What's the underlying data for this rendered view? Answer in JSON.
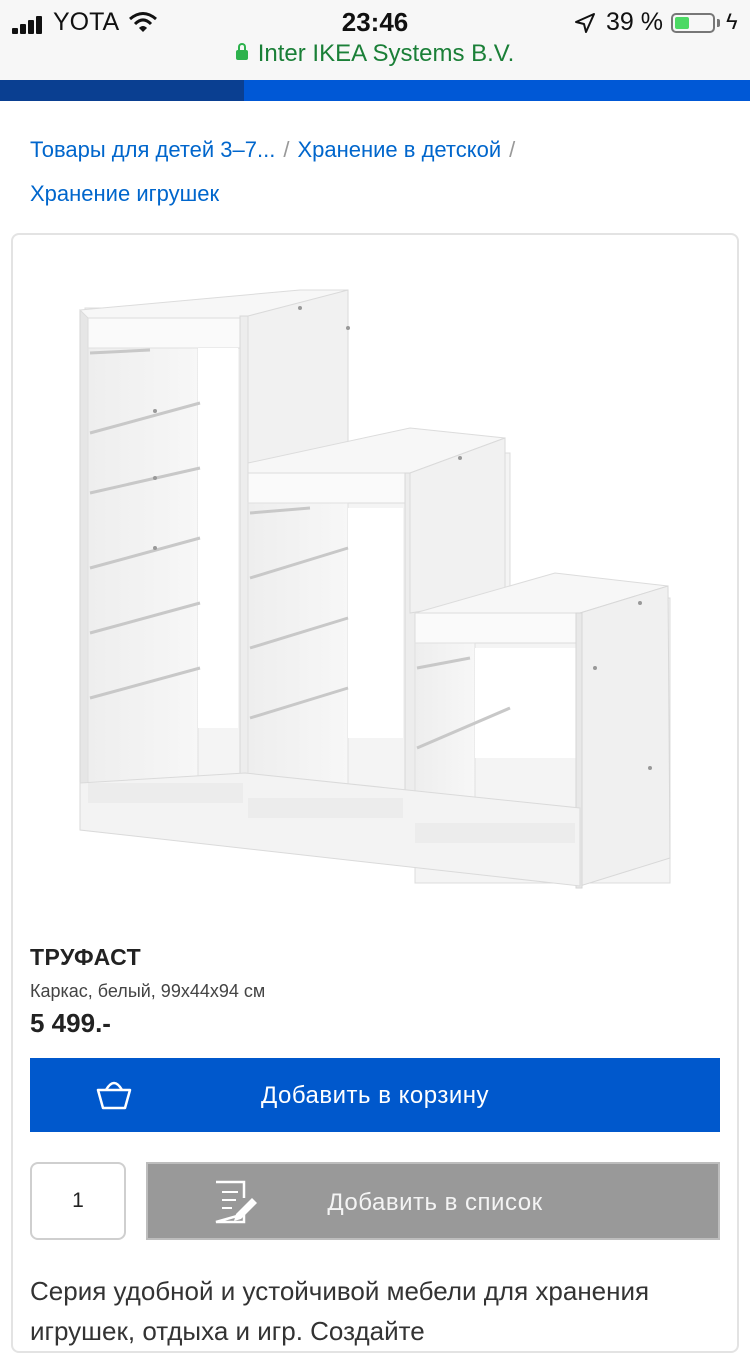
{
  "status_bar": {
    "carrier": "YOTA",
    "time": "23:46",
    "battery_percent": "39 %",
    "battery_level": 0.39
  },
  "browser": {
    "site_owner": "Inter IKEA Systems B.V.",
    "page_load_progress": 0.325
  },
  "breadcrumb": {
    "items": [
      "Товары для детей 3–7...",
      "Хранение в детской",
      "Хранение игрушек"
    ],
    "separator": "/"
  },
  "product": {
    "name": "ТРУФАСТ",
    "description": "Каркас, белый, 99x44x94 см",
    "price": "5 499.-"
  },
  "actions": {
    "add_to_cart": "Добавить в корзину",
    "quantity": "1",
    "add_to_list": "Добавить в список"
  },
  "details": {
    "text": "Серия удобной и устойчивой мебели для хранения игрушек, отдыха и игр. Создайте"
  },
  "colors": {
    "ikea_blue": "#0058cc",
    "progress_blue": "#0a3f91",
    "link_blue": "#0066cc",
    "secure_green": "#1a7f37",
    "disabled_grey": "#999999"
  }
}
